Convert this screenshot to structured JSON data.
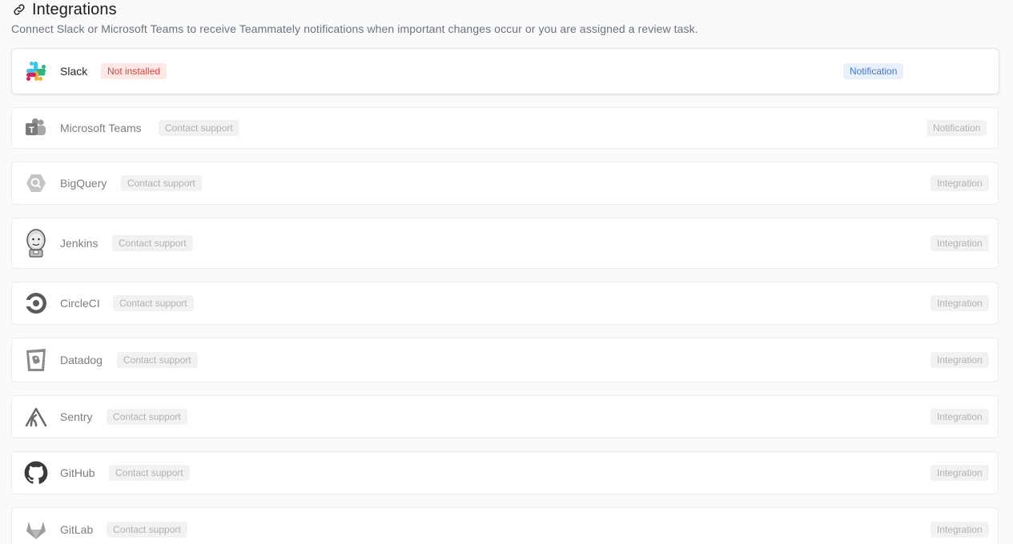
{
  "header": {
    "title": "Integrations",
    "subtitle": "Connect Slack or Microsoft Teams to receive Teammately notifications when important changes occur or you are assigned a review task.",
    "icon": "link-icon"
  },
  "integrations": [
    {
      "name": "Slack",
      "status": "Not installed",
      "type": "Notification",
      "icon": "slack-icon"
    },
    {
      "name": "Microsoft Teams",
      "status": "Contact support",
      "type": "Notification",
      "icon": "microsoft-teams-icon"
    },
    {
      "name": "BigQuery",
      "status": "Contact support",
      "type": "Integration",
      "icon": "bigquery-icon"
    },
    {
      "name": "Jenkins",
      "status": "Contact support",
      "type": "Integration",
      "icon": "jenkins-icon"
    },
    {
      "name": "CircleCI",
      "status": "Contact support",
      "type": "Integration",
      "icon": "circleci-icon"
    },
    {
      "name": "Datadog",
      "status": "Contact support",
      "type": "Integration",
      "icon": "datadog-icon"
    },
    {
      "name": "Sentry",
      "status": "Contact support",
      "type": "Integration",
      "icon": "sentry-icon"
    },
    {
      "name": "GitHub",
      "status": "Contact support",
      "type": "Integration",
      "icon": "github-icon"
    },
    {
      "name": "GitLab",
      "status": "Contact support",
      "type": "Integration",
      "icon": "gitlab-icon"
    }
  ],
  "colors": {
    "danger_text": "#d6453d",
    "danger_bg": "#fde8e6",
    "info_text": "#4a78c4",
    "info_bg": "#e8f0fc",
    "muted_text": "#b1b1b1",
    "muted_bg": "#f2f2f2"
  }
}
